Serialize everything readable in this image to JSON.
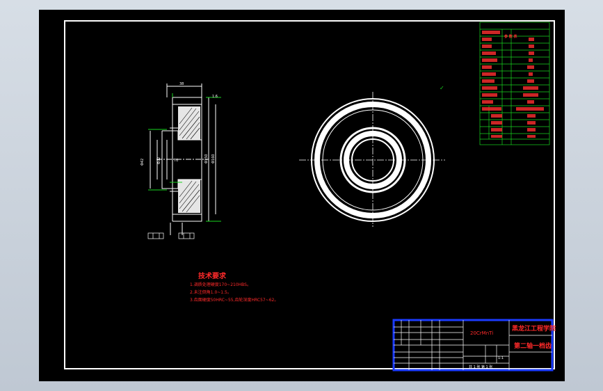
{
  "technical_requirements": {
    "title": "技术要求",
    "lines": [
      "1.调质处理硬度170~210HBS。",
      "2.未注倒角1.0~1.5。",
      "3.齿面硬度50HRC~55,齿轮深度HRC57~62。"
    ]
  },
  "title_block": {
    "material": "20CrMnTi",
    "school": "黑龙江工程学院",
    "part_name": "第二轴一档齿",
    "scale": "1:1",
    "sheets": "共 1 张 第 1 张"
  },
  "param_table": {
    "header": "参 数 表"
  },
  "colors": {
    "sheet": "#000000",
    "border": "#ffffff",
    "annotation": "#ff2a2a",
    "dimension": "#19d61f",
    "title_block_frame": "#1b3bff",
    "surround": "#c9d1dc"
  }
}
